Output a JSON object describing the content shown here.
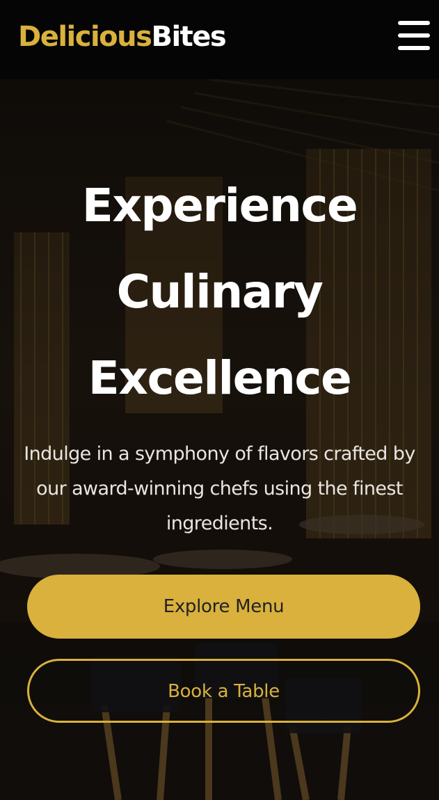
{
  "header": {
    "logo_primary": "Delicious",
    "logo_secondary": "Bites",
    "menu_icon": "hamburger-menu-icon"
  },
  "hero": {
    "title_line1": "Experience",
    "title_line2": "Culinary",
    "title_line3": "Excellence",
    "subtitle": "Indulge in a symphony of flavors crafted by our award-winning chefs using the finest ingredients.",
    "primary_button": "Explore Menu",
    "secondary_button": "Book a Table",
    "background_image": "restaurant-interior"
  },
  "colors": {
    "accent": "#d9b13c",
    "nav_background": "#050505",
    "text": "#ffffff"
  }
}
